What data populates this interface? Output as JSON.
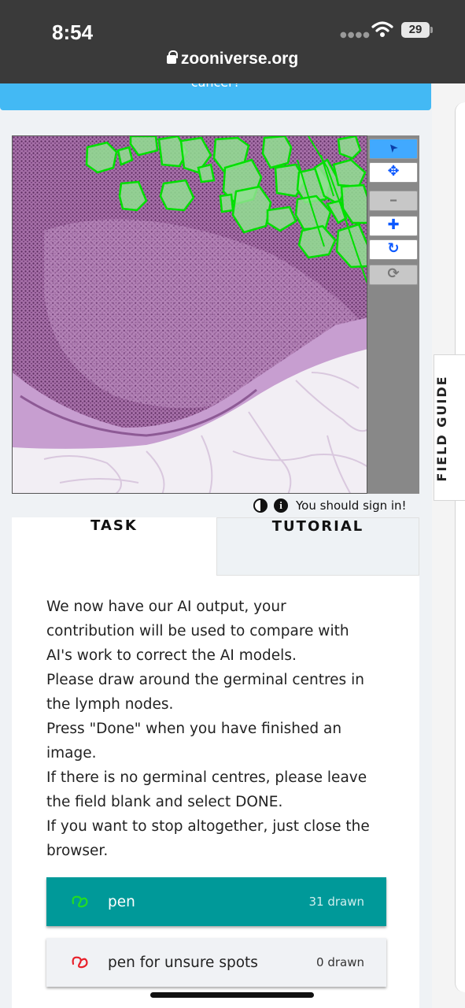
{
  "status_bar": {
    "time": "8:54",
    "battery": "29",
    "url": "zooniverse.org",
    "icons": [
      "signal-dots-icon",
      "wifi-icon",
      "battery-icon",
      "lock-icon"
    ]
  },
  "banner": {
    "text": "cancer?",
    "color": "#43b9f4"
  },
  "field_guide": {
    "label": "FIELD GUIDE"
  },
  "viewer": {
    "toolbar": [
      {
        "name": "annotate-tool-button",
        "icon": "arrow-pointer-icon",
        "glyph": "➤",
        "state": "active"
      },
      {
        "name": "move-tool-button",
        "icon": "move-arrows-icon",
        "glyph": "✥",
        "state": "normal"
      },
      {
        "name": "zoom-out-button",
        "icon": "minus-icon",
        "glyph": "━",
        "state": "disabled"
      },
      {
        "name": "zoom-in-button",
        "icon": "plus-icon",
        "glyph": "✚",
        "state": "normal"
      },
      {
        "name": "rotate-button",
        "icon": "rotate-icon",
        "glyph": "↻",
        "state": "normal"
      },
      {
        "name": "reset-button",
        "icon": "refresh-icon",
        "glyph": "⟳",
        "state": "disabled"
      }
    ]
  },
  "signin": {
    "text": "You should sign in!",
    "icons": [
      "contrast-icon",
      "info-icon"
    ]
  },
  "tabs": {
    "task": "TASK",
    "tutorial": "TUTORIAL"
  },
  "instructions": [
    "We now have our AI output, your",
    "contribution will be used to compare with",
    "AI's work to correct the AI models.",
    "Please draw around the germinal centres in",
    "the lymph nodes.",
    "Press \"Done\" when you have finished an",
    "image.",
    "If there is no germinal centres, please leave",
    "the field blank and select DONE.",
    "If you want to stop altogether, just close the",
    "browser."
  ],
  "tools": [
    {
      "label": "pen",
      "count": "31 drawn",
      "icon_color": "#22dd22",
      "selected": true
    },
    {
      "label": "pen for unsure spots",
      "count": "0 drawn",
      "icon_color": "#e8202a",
      "selected": false
    }
  ],
  "colors": {
    "accent": "#009999",
    "annotation": "#00dd00",
    "tissue": "#b789b8"
  }
}
